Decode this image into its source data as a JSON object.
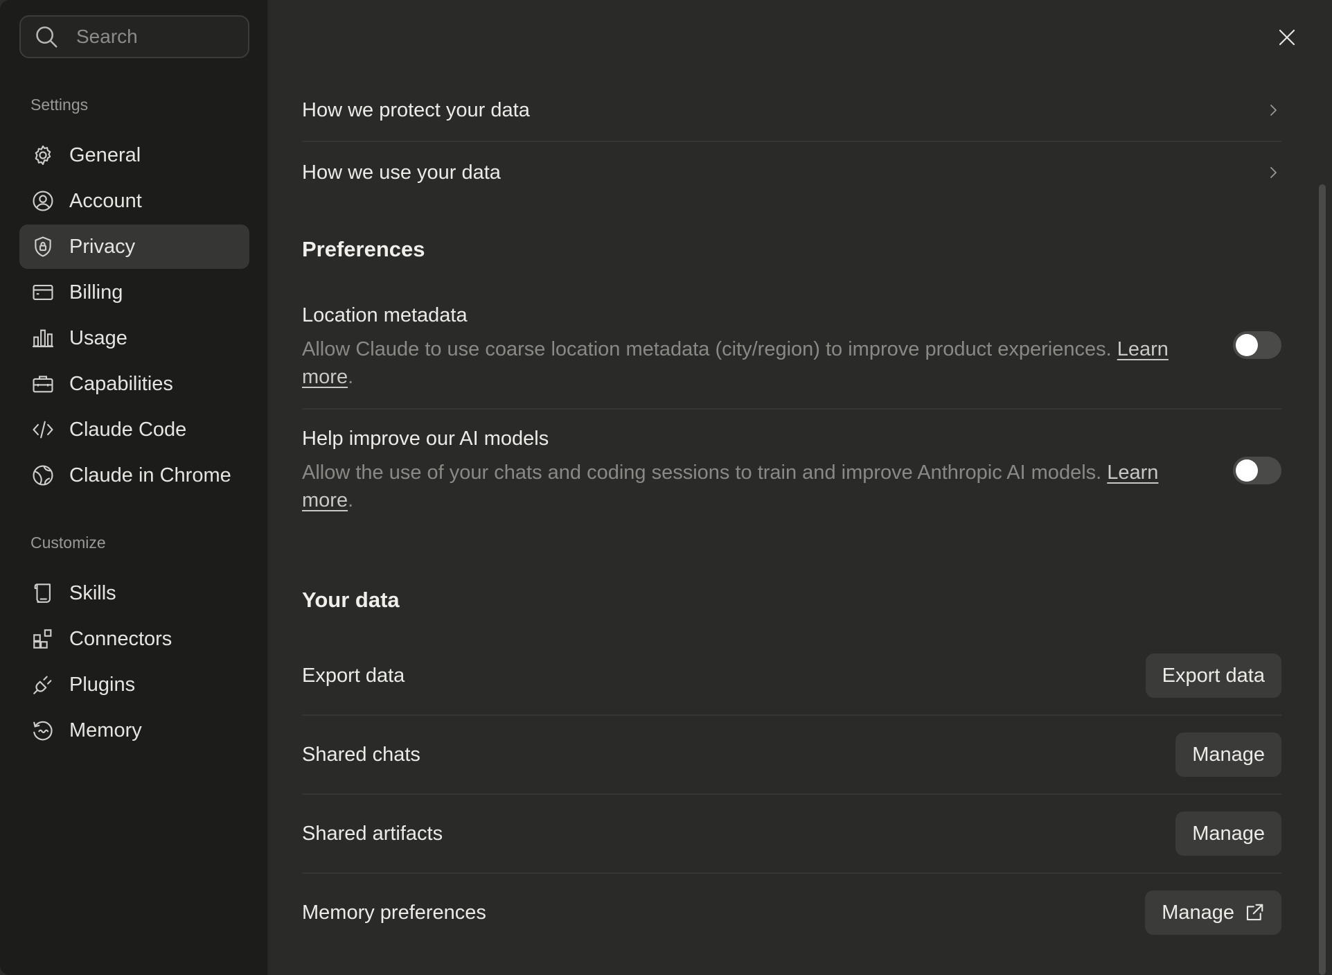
{
  "search": {
    "placeholder": "Search"
  },
  "sidebar": {
    "settings_title": "Settings",
    "settings_items": [
      {
        "label": "General",
        "icon": "gear-icon"
      },
      {
        "label": "Account",
        "icon": "user-circle-icon"
      },
      {
        "label": "Privacy",
        "icon": "shield-lock-icon",
        "active": true
      },
      {
        "label": "Billing",
        "icon": "credit-card-icon"
      },
      {
        "label": "Usage",
        "icon": "bar-chart-icon"
      },
      {
        "label": "Capabilities",
        "icon": "briefcase-icon"
      },
      {
        "label": "Claude Code",
        "icon": "code-icon"
      },
      {
        "label": "Claude in Chrome",
        "icon": "globe-icon"
      }
    ],
    "customize_title": "Customize",
    "customize_items": [
      {
        "label": "Skills",
        "icon": "scroll-icon"
      },
      {
        "label": "Connectors",
        "icon": "blocks-icon"
      },
      {
        "label": "Plugins",
        "icon": "plug-icon"
      },
      {
        "label": "Memory",
        "icon": "memory-icon"
      }
    ]
  },
  "main": {
    "links": [
      {
        "label": "How we protect your data"
      },
      {
        "label": "How we use your data"
      }
    ],
    "preferences_heading": "Preferences",
    "preferences": [
      {
        "title": "Location metadata",
        "description": "Allow Claude to use coarse location metadata (city/region) to improve product experiences.",
        "link": "Learn more",
        "enabled": false
      },
      {
        "title": "Help improve our AI models",
        "description": "Allow the use of your chats and coding sessions to train and improve Anthropic AI models.",
        "link": "Learn more",
        "enabled": false
      }
    ],
    "your_data_heading": "Your data",
    "data_rows": [
      {
        "label": "Export data",
        "button": "Export data"
      },
      {
        "label": "Shared chats",
        "button": "Manage"
      },
      {
        "label": "Shared artifacts",
        "button": "Manage"
      },
      {
        "label": "Memory preferences",
        "button": "Manage",
        "external": true
      }
    ]
  },
  "colors": {
    "sidebar_bg": "#1c1c1b",
    "main_bg": "#2a2a29",
    "active_item_bg": "#363635",
    "button_bg": "#3b3b39",
    "toggle_off": "#4a4a48"
  }
}
